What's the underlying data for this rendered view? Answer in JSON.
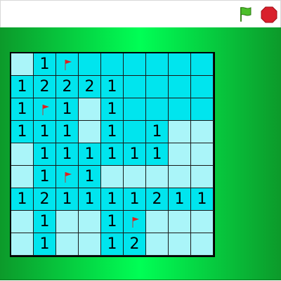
{
  "toolbar": {
    "green_flag_icon": "green-flag-icon",
    "stop_icon": "stop-sign-icon"
  },
  "colors": {
    "open_cell": "#00e5ee",
    "hidden_cell": "#aaf5f9",
    "flag_red": "#e02020",
    "stage_green": "#00ff55"
  },
  "board": {
    "rows": 9,
    "cols": 9,
    "cells": [
      [
        {
          "s": "h",
          "v": ""
        },
        {
          "s": "o",
          "v": "1"
        },
        {
          "s": "f",
          "v": ""
        },
        {
          "s": "o",
          "v": ""
        },
        {
          "s": "o",
          "v": ""
        },
        {
          "s": "o",
          "v": ""
        },
        {
          "s": "o",
          "v": ""
        },
        {
          "s": "o",
          "v": ""
        },
        {
          "s": "o",
          "v": ""
        }
      ],
      [
        {
          "s": "o",
          "v": "1"
        },
        {
          "s": "o",
          "v": "2"
        },
        {
          "s": "o",
          "v": "2"
        },
        {
          "s": "o",
          "v": "2"
        },
        {
          "s": "o",
          "v": "1"
        },
        {
          "s": "o",
          "v": ""
        },
        {
          "s": "o",
          "v": ""
        },
        {
          "s": "o",
          "v": ""
        },
        {
          "s": "o",
          "v": ""
        }
      ],
      [
        {
          "s": "o",
          "v": "1"
        },
        {
          "s": "f",
          "v": ""
        },
        {
          "s": "o",
          "v": "1"
        },
        {
          "s": "h",
          "v": ""
        },
        {
          "s": "o",
          "v": "1"
        },
        {
          "s": "o",
          "v": ""
        },
        {
          "s": "o",
          "v": ""
        },
        {
          "s": "o",
          "v": ""
        },
        {
          "s": "o",
          "v": ""
        }
      ],
      [
        {
          "s": "o",
          "v": "1"
        },
        {
          "s": "o",
          "v": "1"
        },
        {
          "s": "o",
          "v": "1"
        },
        {
          "s": "h",
          "v": ""
        },
        {
          "s": "o",
          "v": "1"
        },
        {
          "s": "o",
          "v": ""
        },
        {
          "s": "o",
          "v": "1"
        },
        {
          "s": "h",
          "v": ""
        },
        {
          "s": "h",
          "v": ""
        }
      ],
      [
        {
          "s": "h",
          "v": ""
        },
        {
          "s": "o",
          "v": "1"
        },
        {
          "s": "o",
          "v": "1"
        },
        {
          "s": "o",
          "v": "1"
        },
        {
          "s": "o",
          "v": "1"
        },
        {
          "s": "o",
          "v": "1"
        },
        {
          "s": "o",
          "v": "1"
        },
        {
          "s": "h",
          "v": ""
        },
        {
          "s": "h",
          "v": ""
        }
      ],
      [
        {
          "s": "h",
          "v": ""
        },
        {
          "s": "o",
          "v": "1"
        },
        {
          "s": "f",
          "v": ""
        },
        {
          "s": "o",
          "v": "1"
        },
        {
          "s": "h",
          "v": ""
        },
        {
          "s": "h",
          "v": ""
        },
        {
          "s": "h",
          "v": ""
        },
        {
          "s": "h",
          "v": ""
        },
        {
          "s": "h",
          "v": ""
        }
      ],
      [
        {
          "s": "o",
          "v": "1"
        },
        {
          "s": "o",
          "v": "2"
        },
        {
          "s": "o",
          "v": "1"
        },
        {
          "s": "o",
          "v": "1"
        },
        {
          "s": "o",
          "v": "1"
        },
        {
          "s": "o",
          "v": "1"
        },
        {
          "s": "o",
          "v": "2"
        },
        {
          "s": "o",
          "v": "1"
        },
        {
          "s": "o",
          "v": "1"
        }
      ],
      [
        {
          "s": "h",
          "v": ""
        },
        {
          "s": "o",
          "v": "1"
        },
        {
          "s": "h",
          "v": ""
        },
        {
          "s": "h",
          "v": ""
        },
        {
          "s": "o",
          "v": "1"
        },
        {
          "s": "f",
          "v": ""
        },
        {
          "s": "h",
          "v": ""
        },
        {
          "s": "h",
          "v": ""
        },
        {
          "s": "h",
          "v": ""
        }
      ],
      [
        {
          "s": "h",
          "v": ""
        },
        {
          "s": "o",
          "v": "1"
        },
        {
          "s": "h",
          "v": ""
        },
        {
          "s": "h",
          "v": ""
        },
        {
          "s": "o",
          "v": "1"
        },
        {
          "s": "o",
          "v": "2"
        },
        {
          "s": "h",
          "v": ""
        },
        {
          "s": "h",
          "v": ""
        },
        {
          "s": "h",
          "v": ""
        }
      ]
    ]
  }
}
